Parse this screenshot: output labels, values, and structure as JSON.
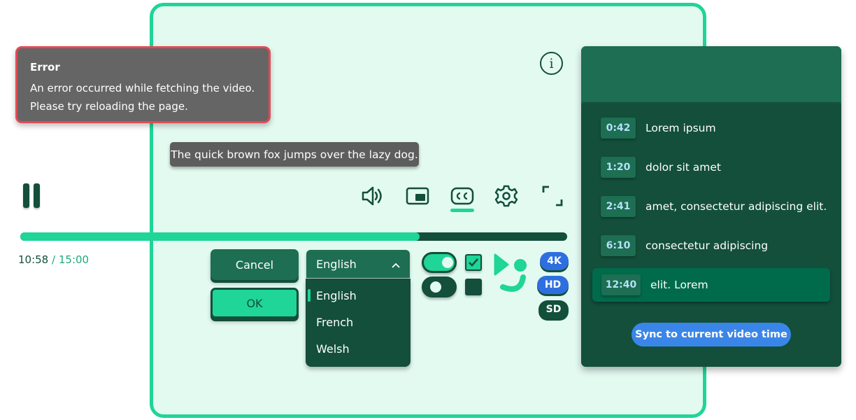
{
  "error": {
    "title": "Error",
    "line1": "An error occurred while fetching the video.",
    "line2": "Please try reloading the page."
  },
  "caption": "The quick brown fox jumps over the lazy dog.",
  "player": {
    "current_time": "10:58",
    "separator": "/",
    "duration": "15:00",
    "progress": 0.73
  },
  "icons": {
    "info": "i",
    "pause": "pause-icon",
    "volume": "volume-icon",
    "pip": "picture-in-picture-icon",
    "cc": "closed-captions-icon",
    "settings": "gear-icon",
    "fullscreen": "fullscreen-icon",
    "select_toggle": "^"
  },
  "buttons": {
    "cancel": "Cancel",
    "ok": "OK",
    "sync": "Sync to current video time"
  },
  "language_select": {
    "selected": "English",
    "options": [
      "English",
      "French",
      "Welsh"
    ]
  },
  "controls": {
    "toggle_on": true,
    "toggle_off": false,
    "checkbox_checked": true,
    "checkbox_unchecked": false
  },
  "quality": {
    "options": [
      "4K",
      "HD",
      "SD"
    ]
  },
  "transcript": {
    "items": [
      {
        "time": "0:42",
        "text": "Lorem ipsum"
      },
      {
        "time": "1:20",
        "text": "dolor sit amet"
      },
      {
        "time": "2:41",
        "text": "amet, consectetur adipiscing elit."
      },
      {
        "time": "6:10",
        "text": "consectetur adipiscing"
      },
      {
        "time": "12:40",
        "text": "elit. Lorem"
      }
    ],
    "active_index": 4
  },
  "colors": {
    "accent": "#1fd597",
    "dark": "#134f3b",
    "mid": "#1d6e52",
    "error_border": "#e34a55",
    "blue": "#2e6fe0"
  }
}
